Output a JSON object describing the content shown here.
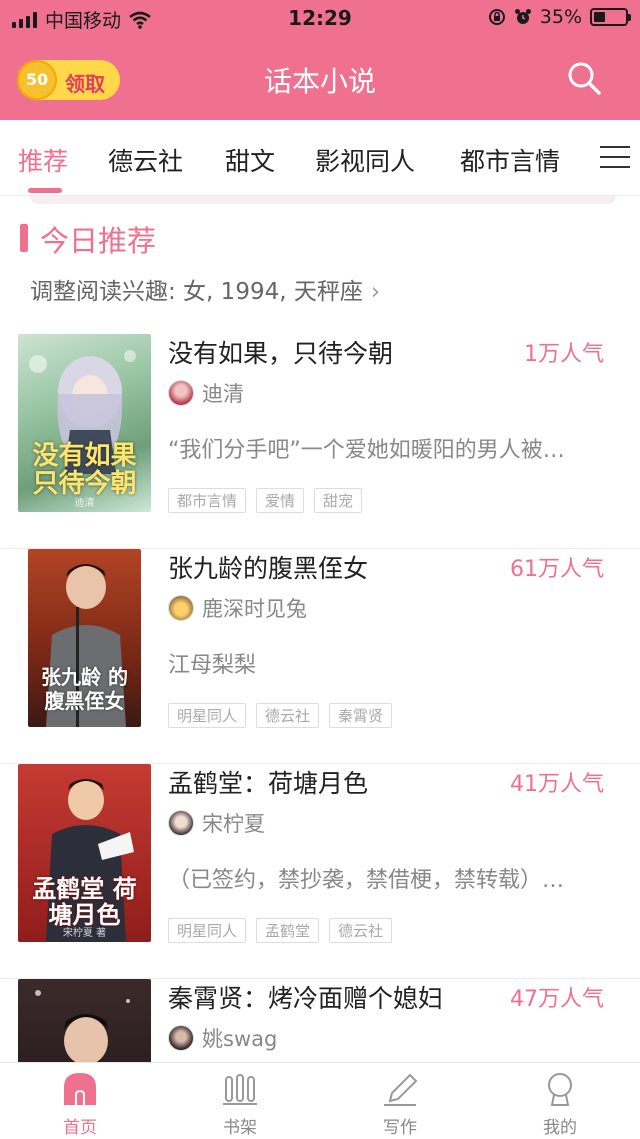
{
  "status_bar": {
    "carrier": "中国移动",
    "time": "12:29",
    "battery": "35%",
    "battery_level": 0.35
  },
  "header": {
    "coin_amount": "50",
    "claim_label": "领取",
    "title": "话本小说",
    "search_icon": "search-icon"
  },
  "tabs": [
    {
      "label": "推荐",
      "active": true
    },
    {
      "label": "德云社"
    },
    {
      "label": "甜文"
    },
    {
      "label": "影视同人"
    },
    {
      "label": "都市言情"
    }
  ],
  "section": {
    "title": "今日推荐",
    "interest": "调整阅读兴趣: 女, 1994, 天秤座"
  },
  "books": [
    {
      "title": "没有如果，只待今朝",
      "popularity": "1万人气",
      "author": "迪清",
      "description": "“我们分手吧”一个爱她如暖阳的男人被…",
      "tags": [
        "都市言情",
        "爱情",
        "甜宠"
      ],
      "cover_text": "没有如果 只待今朝",
      "cover_author": "迪清"
    },
    {
      "title": "张九龄的腹黑侄女",
      "popularity": "61万人气",
      "author": "鹿深时见兔",
      "description": "江母梨梨",
      "tags": [
        "明星同人",
        "德云社",
        "秦霄贤"
      ],
      "cover_text": "张九龄 的腹黑侄女",
      "cover_author": ""
    },
    {
      "title": "孟鹤堂：荷塘月色",
      "popularity": "41万人气",
      "author": "宋柠夏",
      "description": "（已签约，禁抄袭，禁借梗，禁转载）…",
      "tags": [
        "明星同人",
        "孟鹤堂",
        "德云社"
      ],
      "cover_text": "孟鹤堂 荷塘月色",
      "cover_author": "宋柠夏 著"
    },
    {
      "title": "秦霄贤：烤冷面赠个媳妇",
      "popularity": "47万人气",
      "author": "姚swag",
      "description": "",
      "tags": [],
      "cover_text": "",
      "cover_author": ""
    }
  ],
  "bottom_nav": [
    {
      "label": "首页",
      "icon": "home-icon",
      "active": true
    },
    {
      "label": "书架",
      "icon": "bookshelf-icon"
    },
    {
      "label": "写作",
      "icon": "pen-icon"
    },
    {
      "label": "我的",
      "icon": "profile-icon"
    }
  ],
  "colors": {
    "accent": "#f0708f",
    "coin": "#ffd84a"
  }
}
